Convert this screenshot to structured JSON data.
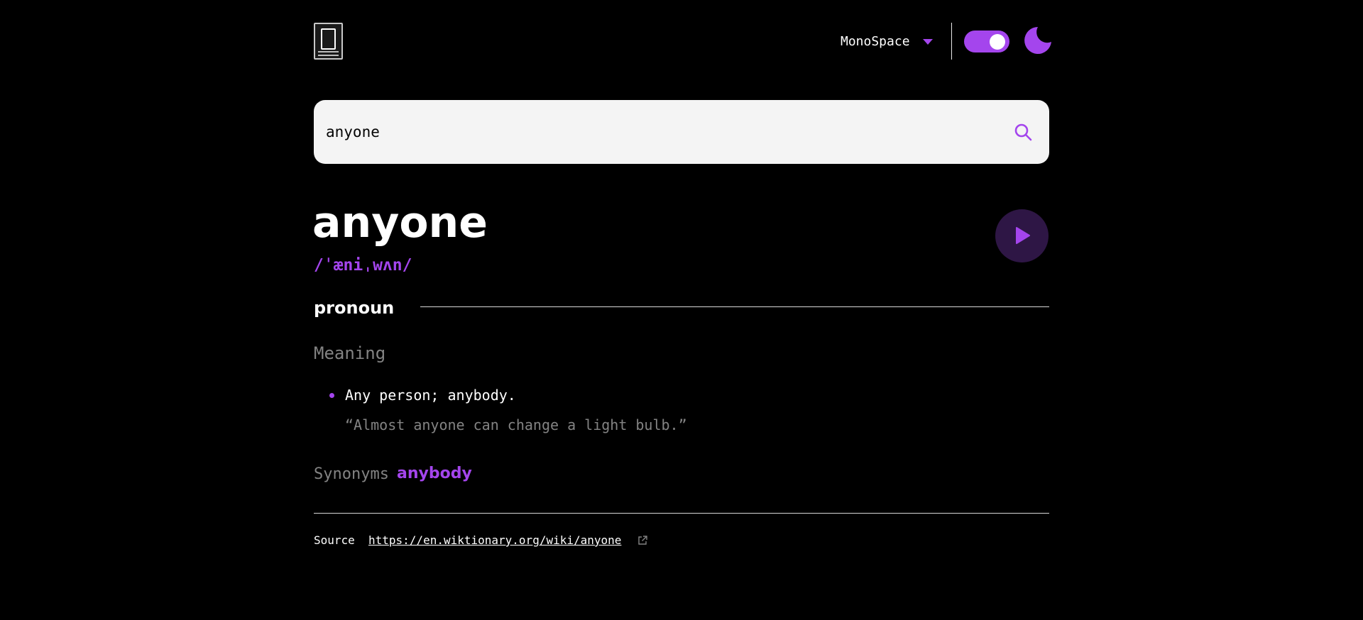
{
  "header": {
    "logo_icon": "book-icon",
    "font_selector": {
      "value": "MonoSpace",
      "icon": "chevron-down-icon"
    },
    "theme_toggle": {
      "state": "on",
      "icon": "moon-icon"
    }
  },
  "search": {
    "value": "anyone",
    "icon": "search-icon"
  },
  "entry": {
    "word": "anyone",
    "phonetic": "/ˈæniˌwʌn/",
    "play_icon": "play-icon",
    "part_of_speech": "pronoun",
    "meaning_label": "Meaning",
    "definitions": [
      {
        "text": "Any person; anybody.",
        "example": "“Almost anyone can change a light bulb.”"
      }
    ],
    "synonyms_label": "Synonyms",
    "synonyms": [
      "anybody"
    ]
  },
  "footer": {
    "source_label": "Source",
    "source_url": "https://en.wiktionary.org/wiki/anyone",
    "link_icon": "external-link-icon"
  },
  "colors": {
    "accent": "#a445ed",
    "background": "#000000",
    "text": "#ffffff",
    "muted": "#838383"
  }
}
